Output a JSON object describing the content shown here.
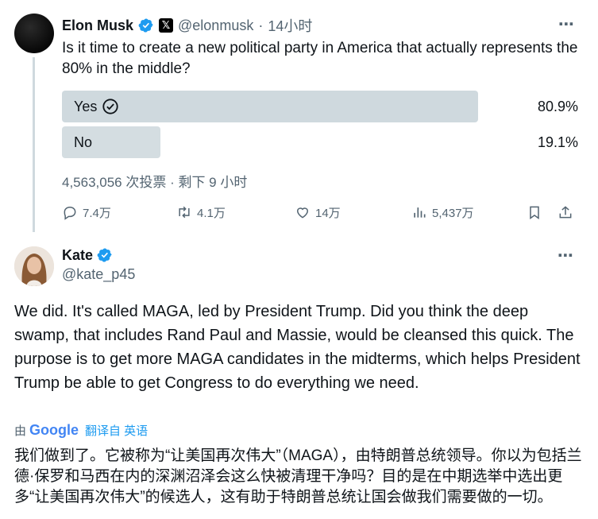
{
  "tweet": {
    "author_name": "Elon Musk",
    "handle": "@elonmusk",
    "separator": "·",
    "time": "14小时",
    "text": "Is it time to create a new political party in America that actually represents the 80% in the middle?",
    "poll": {
      "options": [
        {
          "label": "Yes",
          "percent": "80.9%",
          "fraction": 0.809,
          "selected": true
        },
        {
          "label": "No",
          "percent": "19.1%",
          "fraction": 0.191,
          "selected": false
        }
      ],
      "meta": "4,563,056 次投票 · 剩下 9 小时"
    },
    "actions": {
      "replies": "7.4万",
      "reposts": "4.1万",
      "likes": "14万",
      "views": "5,437万"
    }
  },
  "reply": {
    "author_name": "Kate",
    "handle": "@kate_p45",
    "text": "We did. It's called MAGA, led by President Trump. Did you think the deep swamp, that includes Rand Paul and Massie, would be cleansed this quick. The purpose is to get more MAGA candidates in the midterms, which helps President Trump be able to get Congress to do everything we need.",
    "translation_prefix": "由",
    "translation_provider": "Google",
    "translation_link": "翻译自 英语",
    "translated_text": "我们做到了。它被称为“让美国再次伟大”（MAGA），由特朗普总统领导。你以为包括兰德·保罗和马西在内的深渊沼泽会这么快被清理干净吗？目的是在中期选举中选出更多“让美国再次伟大”的候选人，这有助于特朗普总统让国会做我们需要做的一切。"
  },
  "icons": {
    "more": "⋯",
    "x_badge": "𝕏"
  },
  "colors": {
    "verified": "#1d9bf0",
    "poll_bar": "#cfd9de",
    "muted_text": "#536471",
    "link": "#1d9bf0"
  }
}
